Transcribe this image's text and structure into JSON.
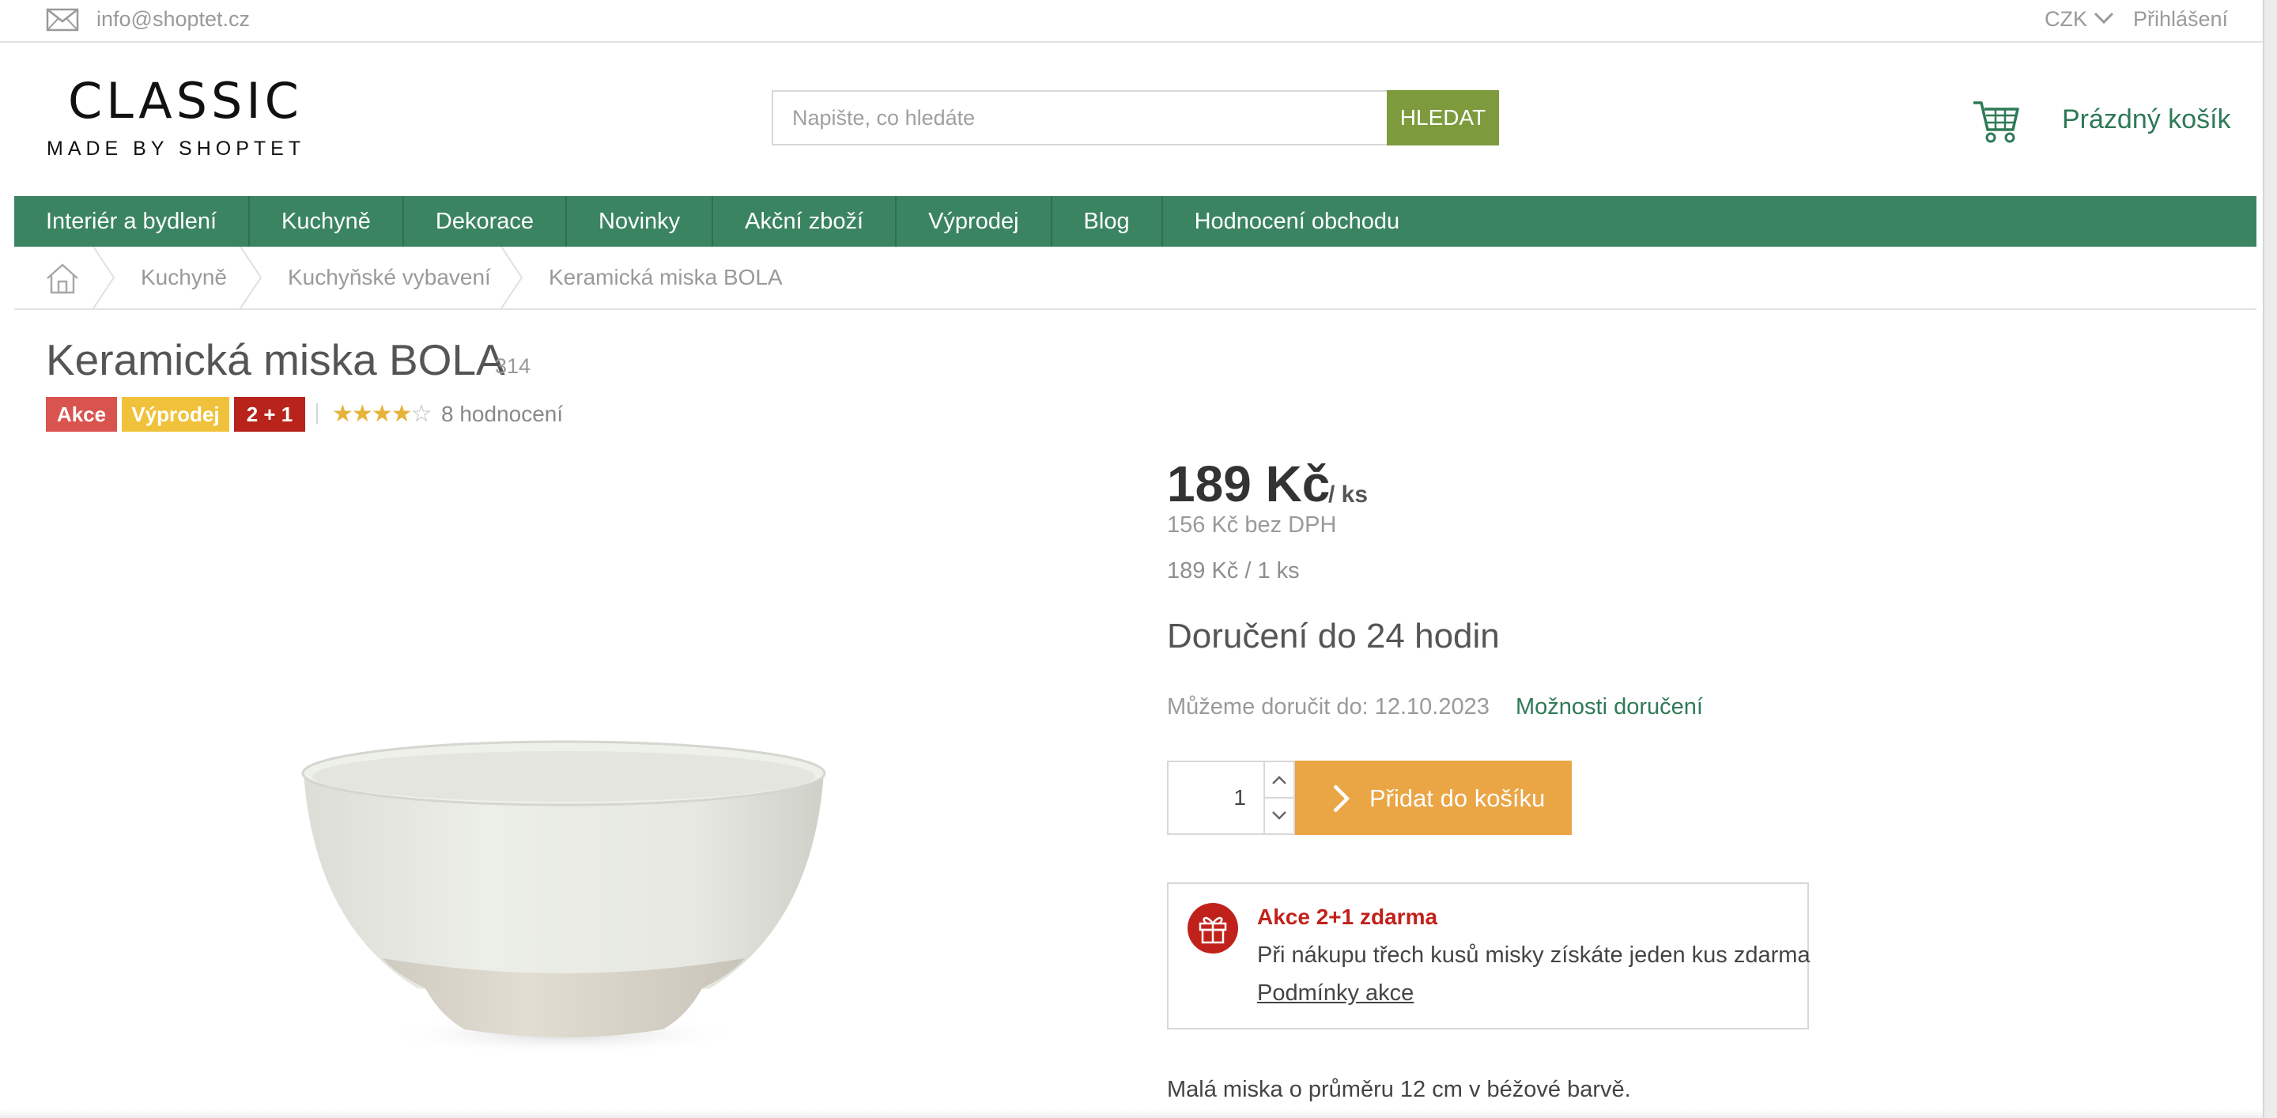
{
  "topbar": {
    "email": "info@shoptet.cz",
    "currency": "CZK",
    "login": "Přihlášení"
  },
  "header": {
    "logo_title": "CLASSIC",
    "logo_subtitle": "MADE BY SHOPTET",
    "search_placeholder": "Napište, co hledáte",
    "search_button": "HLEDAT",
    "cart_label": "Prázdný košík"
  },
  "nav": {
    "items": [
      {
        "label": "Interiér a bydlení"
      },
      {
        "label": "Kuchyně"
      },
      {
        "label": "Dekorace"
      },
      {
        "label": "Novinky"
      },
      {
        "label": "Akční zboží"
      },
      {
        "label": "Výprodej"
      },
      {
        "label": "Blog"
      },
      {
        "label": "Hodnocení obchodu"
      }
    ]
  },
  "breadcrumb": {
    "items": [
      {
        "label": "Kuchyně"
      },
      {
        "label": "Kuchyňské vybavení"
      },
      {
        "label": "Keramická miska BOLA"
      }
    ]
  },
  "product": {
    "title": "Keramická miska BOLA",
    "code": "314",
    "flags": [
      {
        "label": "Akce",
        "color": "#d9534f"
      },
      {
        "label": "Výprodej",
        "color": "#f0c23b"
      },
      {
        "label": "2 + 1",
        "color": "#b8231c"
      }
    ],
    "rating_stars": 4,
    "rating_max": 5,
    "rating_count_text": "8 hodnocení",
    "price": "189 Kč",
    "price_unit": "/ ks",
    "price_without_vat": "156 Kč bez DPH",
    "price_per_unit": "189 Kč / 1 ks",
    "delivery_title": "Doručení do 24 hodin",
    "delivery_date_text": "Můžeme doručit do: 12.10.2023",
    "delivery_options_link": "Možnosti doručení",
    "quantity": "1",
    "add_to_cart": "Přidat do košíku",
    "short_description": "Malá miska o průměru 12 cm v béžové barvě."
  },
  "promo": {
    "title": "Akce 2+1 zdarma",
    "text": "Při nákupu třech kusů misky získáte jeden kus zdarma",
    "link": "Podmínky akce"
  },
  "colors": {
    "brand_green": "#3b8462",
    "search_green": "#7d9b3d",
    "link_green": "#2f7a56",
    "add_to_cart_orange": "#eaa545",
    "promo_red": "#c0221b",
    "star_gold": "#e6b33b"
  },
  "icons": {
    "topbar_mail": "envelope-icon",
    "header_cart": "cart-icon",
    "breadcrumb_home": "home-icon",
    "promo": "gift-icon"
  }
}
